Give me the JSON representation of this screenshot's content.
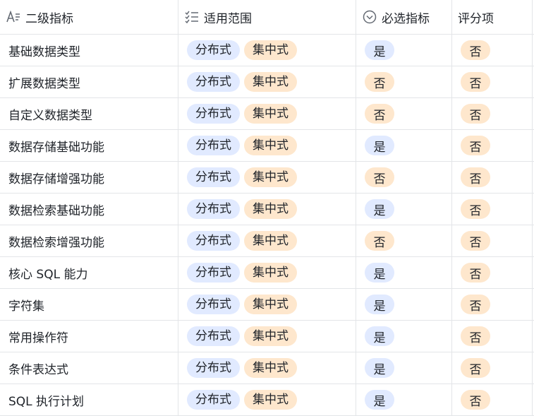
{
  "headers": {
    "col1": "二级指标",
    "col2": "适用范围",
    "col3": "必选指标",
    "col4": "评分项"
  },
  "tag_labels": {
    "distributed": "分布式",
    "centralized": "集中式"
  },
  "colors": {
    "blue_tag": "#e1eaff",
    "orange_tag": "#fee7cd",
    "yes_bg": "#e1eaff",
    "no_bg": "#fee7cd",
    "border": "#e3e5e8"
  },
  "rows": [
    {
      "name": "基础数据类型",
      "required": "是",
      "scoring": "否"
    },
    {
      "name": "扩展数据类型",
      "required": "否",
      "scoring": "否"
    },
    {
      "name": "自定义数据类型",
      "required": "否",
      "scoring": "否"
    },
    {
      "name": "数据存储基础功能",
      "required": "是",
      "scoring": "否"
    },
    {
      "name": "数据存储增强功能",
      "required": "否",
      "scoring": "否"
    },
    {
      "name": "数据检索基础功能",
      "required": "是",
      "scoring": "否"
    },
    {
      "name": "数据检索增强功能",
      "required": "否",
      "scoring": "否"
    },
    {
      "name": "核心 SQL 能力",
      "required": "是",
      "scoring": "否"
    },
    {
      "name": "字符集",
      "required": "是",
      "scoring": "否"
    },
    {
      "name": "常用操作符",
      "required": "是",
      "scoring": "否"
    },
    {
      "name": "条件表达式",
      "required": "是",
      "scoring": "否"
    },
    {
      "name": "SQL 执行计划",
      "required": "是",
      "scoring": "否"
    }
  ]
}
